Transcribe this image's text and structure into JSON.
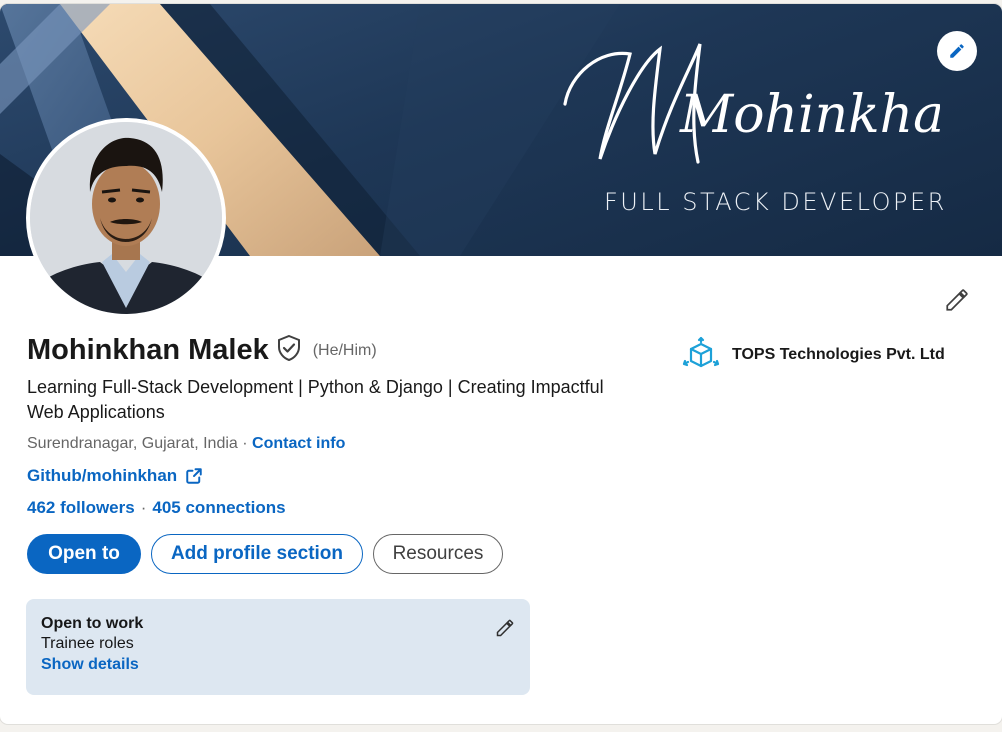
{
  "banner": {
    "signature_text": "Mohinkhan",
    "subtitle": "FULL STACK DEVELOPER",
    "edit_icon": "pencil-icon"
  },
  "profile": {
    "name": "Mohinkhan Malek",
    "pronouns": "(He/Him)",
    "verified_icon": "verified-shield-icon",
    "headline": "Learning Full-Stack Development | Python & Django | Creating Impactful Web Applications",
    "location": "Surendranagar, Gujarat, India",
    "location_separator": "·",
    "contact_info": "Contact info",
    "website_label": "Github/mohinkhan",
    "website_icon": "external-link-icon",
    "followers": "462 followers",
    "stats_separator": "·",
    "connections": "405 connections"
  },
  "actions": {
    "open_to": "Open to",
    "add_section": "Add profile section",
    "resources": "Resources"
  },
  "company": {
    "name": "TOPS Technologies Pvt. Ltd",
    "logo_icon": "tops-cube-logo-icon"
  },
  "open_to_work": {
    "title": "Open to work",
    "roles": "Trainee roles",
    "details_link": "Show details"
  },
  "colors": {
    "accent": "#0a66c2",
    "banner_dark": "#1e3756",
    "open_to_work_bg": "#dde7f1"
  }
}
